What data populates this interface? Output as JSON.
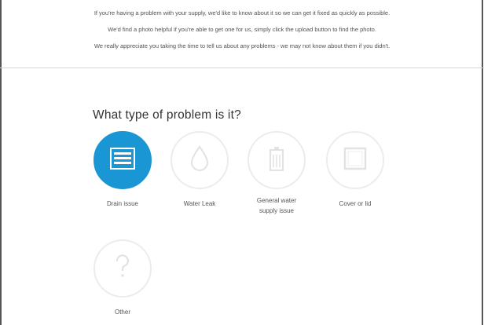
{
  "intro": {
    "line1": "If you're having a problem with your supply, we'd like to know about it so we can get it fixed as quickly as possible.",
    "line2": "We'd find a photo helpful if you're able to get one for us, simply click the upload button to find the photo.",
    "line3": "We really appreciate you taking the time to tell us about any problems - we may not know about them if you didn't."
  },
  "question": "What type of problem is it?",
  "options": [
    {
      "label": "Drain issue",
      "icon": "drain-icon",
      "selected": true
    },
    {
      "label": "Water Leak",
      "icon": "water-drop-icon",
      "selected": false
    },
    {
      "label": "General water supply issue",
      "label_line1": "General water",
      "label_line2": "supply issue",
      "icon": "water-supply-icon",
      "selected": false
    },
    {
      "label": "Cover or lid",
      "icon": "cover-lid-icon",
      "selected": false
    },
    {
      "label": "Other",
      "icon": "question-icon",
      "selected": false
    }
  ],
  "colors": {
    "accent": "#1b96d4",
    "circle_border": "#ececec",
    "icon_faint": "#e2e2e2"
  }
}
